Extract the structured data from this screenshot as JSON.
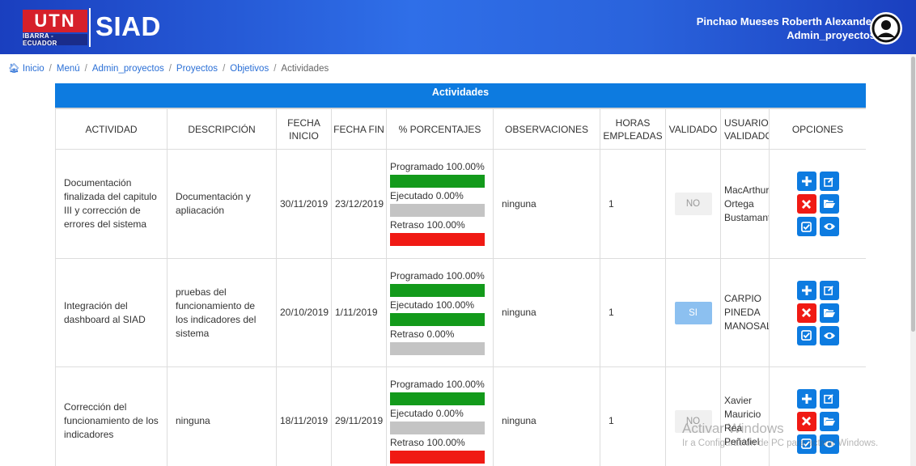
{
  "header": {
    "logo_text": "UTN",
    "logo_subtext": "IBARRA - ECUADOR",
    "app_name": "SIAD",
    "user_name": "Pinchao Mueses Roberth Alexander",
    "user_role": "Admin_proyectos"
  },
  "breadcrumb": {
    "home": "Inicio",
    "items": [
      "Menú",
      "Admin_proyectos",
      "Proyectos",
      "Objetivos"
    ],
    "current": "Actividades"
  },
  "panel": {
    "title": "Actividades",
    "columns": [
      "ACTIVIDAD",
      "DESCRIPCIÓN",
      "FECHA INICIO",
      "FECHA FIN",
      "% PORCENTAJES",
      "OBSERVACIONES",
      "HORAS EMPLEADAS",
      "VALIDADO",
      "USUARIO VALIDADOR",
      "OPCIONES"
    ]
  },
  "rows": [
    {
      "actividad": "Documentación finalizada del capitulo III y corrección de errores del sistema",
      "descripcion": "Documentación y apliacación",
      "fecha_inicio": "30/11/2019",
      "fecha_fin": "23/12/2019",
      "programado": "Programado 100.00%",
      "ejecutado": "Ejecutado 0.00%",
      "retraso": "Retraso 100.00%",
      "observaciones": "ninguna",
      "horas": "1",
      "validado": "NO",
      "usuario": "MacArthur Ortega Bustamante"
    },
    {
      "actividad": "Integración del dashboard al SIAD",
      "descripcion": "pruebas del funcionamiento de los indicadores del sistema",
      "fecha_inicio": "20/10/2019",
      "fecha_fin": "1/11/2019",
      "programado": "Programado 100.00%",
      "ejecutado": "Ejecutado 100.00%",
      "retraso": "Retraso 0.00%",
      "observaciones": "ninguna",
      "horas": "1",
      "validado": "SI",
      "usuario": "CARPIO PINEDA MANOSALVAS"
    },
    {
      "actividad": "Corrección del funcionamiento de los indicadores",
      "descripcion": "ninguna",
      "fecha_inicio": "18/11/2019",
      "fecha_fin": "29/11/2019",
      "programado": "Programado 100.00%",
      "ejecutado": "Ejecutado 0.00%",
      "retraso": "Retraso 100.00%",
      "observaciones": "ninguna",
      "horas": "1",
      "validado": "NO",
      "usuario": "Xavier Mauricio Rea Peñafiel"
    }
  ],
  "watermark": {
    "line1": "Activar Windows",
    "line2": "Ir a Configuración de PC para activar Windows."
  },
  "colors": {
    "primary": "#0d7be0",
    "bar_green": "#139a1b",
    "bar_gray": "#c4c4c4",
    "bar_red": "#f01a14"
  }
}
